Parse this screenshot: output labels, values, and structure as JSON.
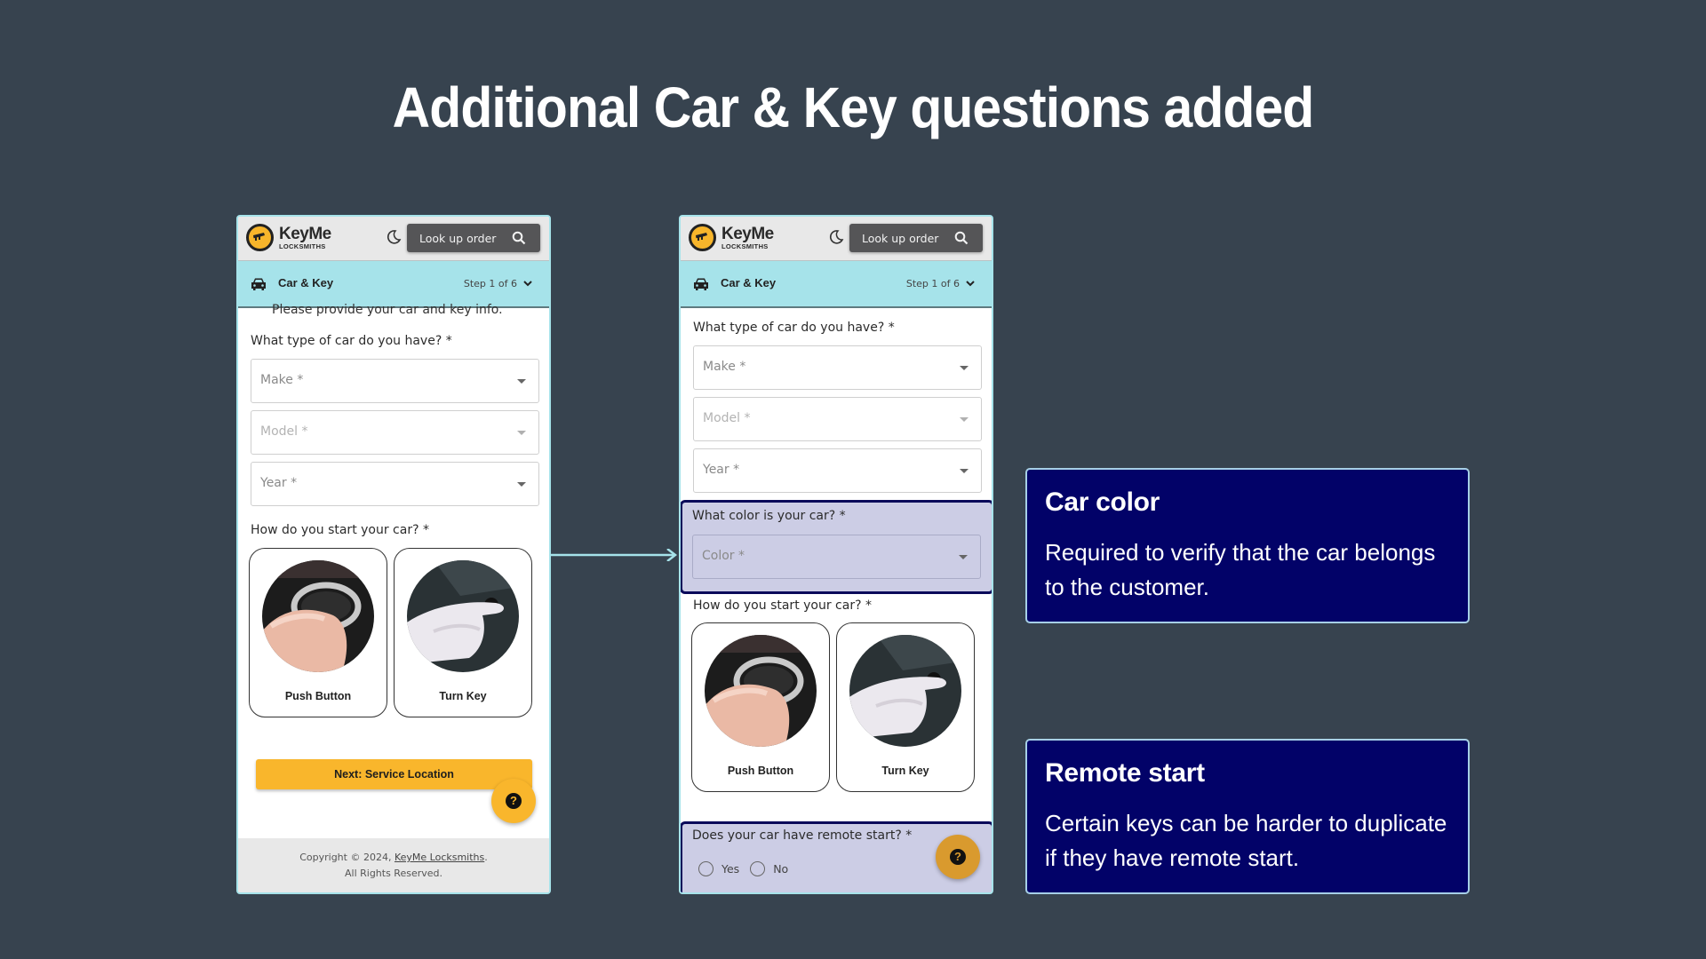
{
  "slide": {
    "title": "Additional Car & Key questions added"
  },
  "app": {
    "logo_name": "KeyMe",
    "logo_sub": "LOCKSMITHS",
    "lookup_label": "Look up order",
    "step_title": "Car & Key",
    "step_count": "Step 1 of 6",
    "intro_clipped": "Please provide your car and key info.",
    "car_question": "What type of car do you have? *",
    "make_placeholder": "Make *",
    "model_placeholder": "Model *",
    "year_placeholder": "Year *",
    "start_question": "How do you start your car? *",
    "start_options": [
      {
        "label": "Push Button"
      },
      {
        "label": "Turn Key"
      }
    ],
    "next_button": "Next: Service Location",
    "help_glyph": "?",
    "footer_prefix": "Copyright © 2024, ",
    "footer_link": "KeyMe Locksmiths",
    "footer_suffix": ".",
    "footer_rights": "All Rights Reserved."
  },
  "new_questions": {
    "color_question": "What color is your car? *",
    "color_placeholder": "Color *",
    "remote_question": "Does your car have remote start? *",
    "remote_options": [
      "Yes",
      "No"
    ]
  },
  "callouts": [
    {
      "title": "Car color",
      "body": "Required to verify that the car belongs to the customer."
    },
    {
      "title": "Remote start",
      "body": "Certain keys can be harder to duplicate if they have remote start."
    }
  ],
  "colors": {
    "background": "#37434f",
    "brand_yellow": "#f9b62c",
    "step_bar": "#a6e3ea",
    "highlight_fill": "#cccde5",
    "callout_navy": "#020268"
  }
}
